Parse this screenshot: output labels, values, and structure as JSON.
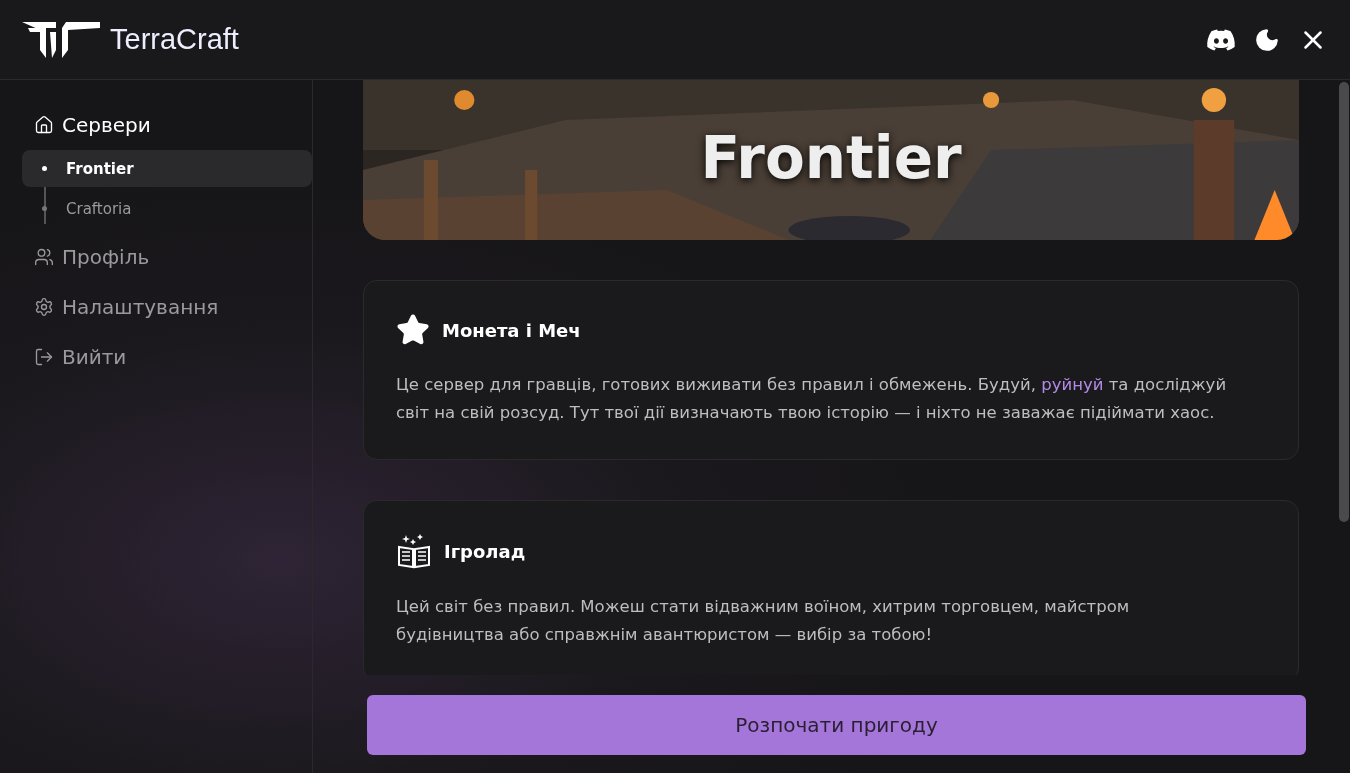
{
  "app": {
    "name": "TerraCraft"
  },
  "nav": [
    {
      "label": "Сервери",
      "kind": "home",
      "selected": true,
      "children": [
        {
          "label": "Frontier",
          "selected": true
        },
        {
          "label": "Craftoria",
          "selected": false
        }
      ]
    },
    {
      "label": "Профіль",
      "kind": "users",
      "selected": false
    },
    {
      "label": "Налаштування",
      "kind": "gear",
      "selected": false
    },
    {
      "label": "Вийти",
      "kind": "logout",
      "selected": false
    }
  ],
  "banner": {
    "kind": "picture",
    "title": "Frontier"
  },
  "cards": [
    {
      "kind": "star",
      "title": "Монета і Меч",
      "text_before": "Це сервер для гравців, готових виживати без правил і обмежень. Будуй,",
      "link": "руйнуй",
      "text_after": "та досліджуй світ на свій розсуд. Тут твої дії визначають твою історію — і ніхто не заважає підіймати хаос."
    },
    {
      "kind": "book",
      "title": "Ігролад",
      "text_before": "Цей світ без правил. Можеш стати відважним воїном, хитрим торговцем, майстром будівництва або справжнім авантюристом — вибір за тобою!"
    }
  ],
  "start_button": "Розпочати пригоду"
}
